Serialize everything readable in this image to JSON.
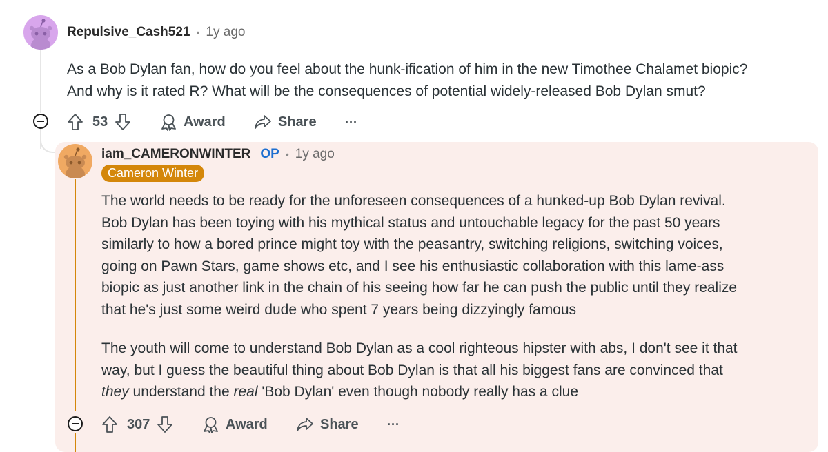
{
  "comment": {
    "username": "Repulsive_Cash521",
    "time": "1y ago",
    "body_lines": [
      "As a Bob Dylan fan, how do you feel about the hunk-ification of him in the new Timothee Chalamet biopic?",
      "And why is it rated R? What will be the consequences of potential widely-released Bob Dylan smut?"
    ],
    "score": "53",
    "award_label": "Award",
    "share_label": "Share",
    "more_label": "···"
  },
  "reply": {
    "username": "iam_CAMERONWINTER",
    "op_label": "OP",
    "time": "1y ago",
    "flair": "Cameron Winter",
    "para1_lines": [
      "The world needs to be ready for the unforeseen consequences of a hunked-up Bob Dylan revival.",
      "Bob Dylan has been toying with his mythical status and untouchable legacy for the past 50 years",
      "similarly to how a bored prince might toy with the peasantry, switching religions, switching voices,",
      "going on Pawn Stars, game shows etc, and I see his enthusiastic collaboration with this lame-ass",
      "biopic as just another link in the chain of his seeing how far he can push the public until they realize",
      "that he's just some weird dude who spent 7 years being dizzyingly famous"
    ],
    "para2_line1": "The youth will come to understand Bob Dylan as a cool righteous hipster with abs, I don't see it that",
    "para2_line2": "way, but I guess the beautiful thing about Bob Dylan is that all his biggest fans are convinced that",
    "para2_line3": {
      "em1": "they",
      "mid": " understand the ",
      "em2": "real",
      "rest": " 'Bob Dylan' even though nobody really has a clue"
    },
    "score": "307",
    "award_label": "Award",
    "share_label": "Share",
    "more_label": "···"
  },
  "colors": {
    "reply_background": "#fbeeeb",
    "flair_background": "#d4870a",
    "op_color": "#1e6fd0",
    "avatar1": "#d8a6ec",
    "avatar2": "#f0a962"
  }
}
